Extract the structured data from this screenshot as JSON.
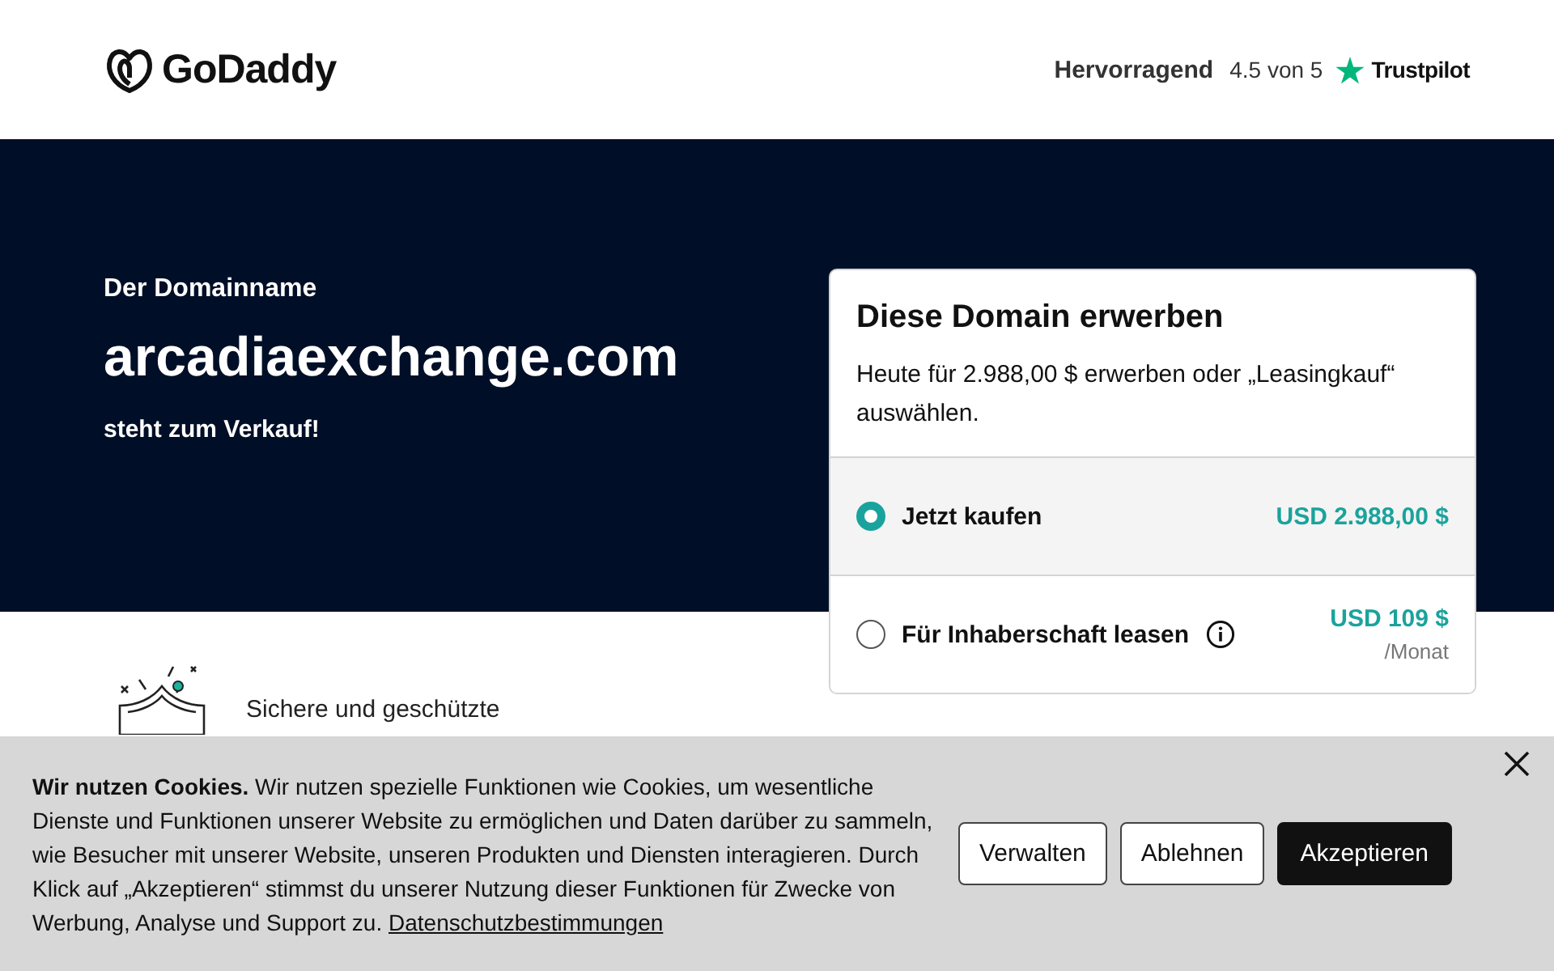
{
  "header": {
    "logo": "GoDaddy",
    "rating_label": "Hervorragend",
    "rating_score": "4.5 von 5",
    "rating_brand": "Trustpilot"
  },
  "hero": {
    "eyebrow": "Der Domainname",
    "domain": "arcadiaexchange.com",
    "tagline": "steht zum Verkauf!"
  },
  "purchase_card": {
    "title": "Diese Domain erwerben",
    "description": "Heute für 2.988,00 $ erwerben oder „Leasingkauf“ auswählen.",
    "options": [
      {
        "label": "Jetzt kaufen",
        "price": "USD 2.988,00 $",
        "selected": true,
        "info": false
      },
      {
        "label": "Für Inhaberschaft leasen",
        "price": "USD 109 $",
        "period": "/Monat",
        "selected": false,
        "info": true
      }
    ]
  },
  "features": [
    {
      "title": "Sichere und geschützte"
    }
  ],
  "cookie_banner": {
    "text": "**Wir nutzen Cookies.** Wir nutzen spezielle Funktionen wie Cookies, um wesentliche Dienste und Funktionen unserer Website zu ermöglichen und Daten darüber zu sammeln, wie Besucher mit unserer Website, unseren Produkten und Diensten interagieren. Durch Klick auf „Akzeptieren“ stimmst du unserer Nutzung dieser Funktionen für Zwecke von Werbung, Analyse und Support zu.",
    "link": "Datenschutzbestimmungen",
    "buttons": [
      {
        "label": "Verwalten",
        "kind": "outline"
      },
      {
        "label": "Ablehnen",
        "kind": "outline"
      },
      {
        "label": "Akzeptieren",
        "kind": "primary"
      }
    ]
  }
}
